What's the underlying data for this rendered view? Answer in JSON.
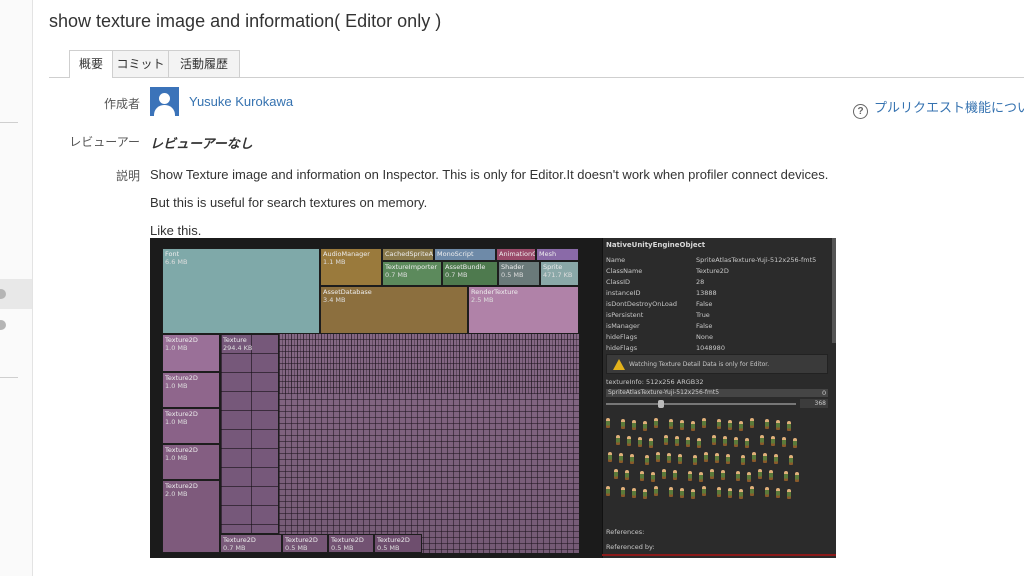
{
  "page": {
    "title": "show texture image and information( Editor only )",
    "tabs": [
      {
        "label": "概要",
        "active": true
      },
      {
        "label": "コミット",
        "active": false
      },
      {
        "label": "活動履歴",
        "active": false
      }
    ]
  },
  "details": {
    "author_label": "作成者",
    "author_name": "Yusuke Kurokawa",
    "reviewer_label": "レビューアー",
    "reviewer_value": "レビューアーなし",
    "description_label": "説明",
    "description_lines": [
      "Show Texture image and information on Inspector. This is only for Editor.It doesn't work when profiler connect devices.",
      "But this is useful for search textures on memory.",
      "Like this."
    ]
  },
  "help_link": "プルリクエスト機能について",
  "screenshot": {
    "treemap": {
      "blocks": [
        {
          "name": "Font",
          "size": "6.6 MB"
        },
        {
          "name": "AudioManager",
          "size": "1.1 MB"
        },
        {
          "name": "CachedSpriteA",
          "size": ""
        },
        {
          "name": "MonoScript",
          "size": ""
        },
        {
          "name": "AnimationC",
          "size": ""
        },
        {
          "name": "Mesh",
          "size": ""
        },
        {
          "name": "TextureImporter",
          "size": "0.7 MB"
        },
        {
          "name": "AssetBundle",
          "size": "0.7 MB"
        },
        {
          "name": "Shader",
          "size": "0.5 MB"
        },
        {
          "name": "Sprite",
          "size": "471.7 KB"
        },
        {
          "name": "AssetDatabase",
          "size": "3.4 MB"
        },
        {
          "name": "RenderTexture",
          "size": "2.5 MB"
        },
        {
          "name": "Texture2D",
          "size": "1.0 MB"
        },
        {
          "name": "Texture2D",
          "size": "1.0 MB"
        },
        {
          "name": "Texture2D",
          "size": "1.0 MB"
        },
        {
          "name": "Texture2D",
          "size": "1.0 MB"
        },
        {
          "name": "Texture2D",
          "size": "2.0 MB"
        },
        {
          "name": "Texture2D",
          "size": "0.7 MB"
        },
        {
          "name": "Texture2D",
          "size": "0.5 MB"
        },
        {
          "name": "Texture2D",
          "size": "0.5 MB"
        },
        {
          "name": "Texture2D",
          "size": "0.5 MB"
        },
        {
          "name": "Texture",
          "size": "294.4 KB"
        }
      ]
    },
    "inspector": {
      "header": "NativeUnityEngineObject",
      "rows": [
        {
          "k": "Name",
          "v": "SpriteAtlasTexture-Yuji-512x256-fmt5"
        },
        {
          "k": "ClassName",
          "v": "Texture2D"
        },
        {
          "k": "ClassID",
          "v": "28"
        },
        {
          "k": "instanceID",
          "v": "13888"
        },
        {
          "k": "isDontDestroyOnLoad",
          "v": "False"
        },
        {
          "k": "isPersistent",
          "v": "True"
        },
        {
          "k": "isManager",
          "v": "False"
        },
        {
          "k": "hideFlags",
          "v": "None"
        },
        {
          "k": "hideFlags",
          "v": "1048980"
        }
      ],
      "warning": "Watching Texture Detail Data is only for Editor.",
      "texture_info": "textureInfo: 512x256 ARGB32",
      "object_field": "SpriteAtlasTexture-Yuji-512x256-fmt5",
      "object_field_value": "0",
      "slider_value": "368",
      "references_label": "References:",
      "referenced_by_label": "Referenced by:"
    }
  }
}
